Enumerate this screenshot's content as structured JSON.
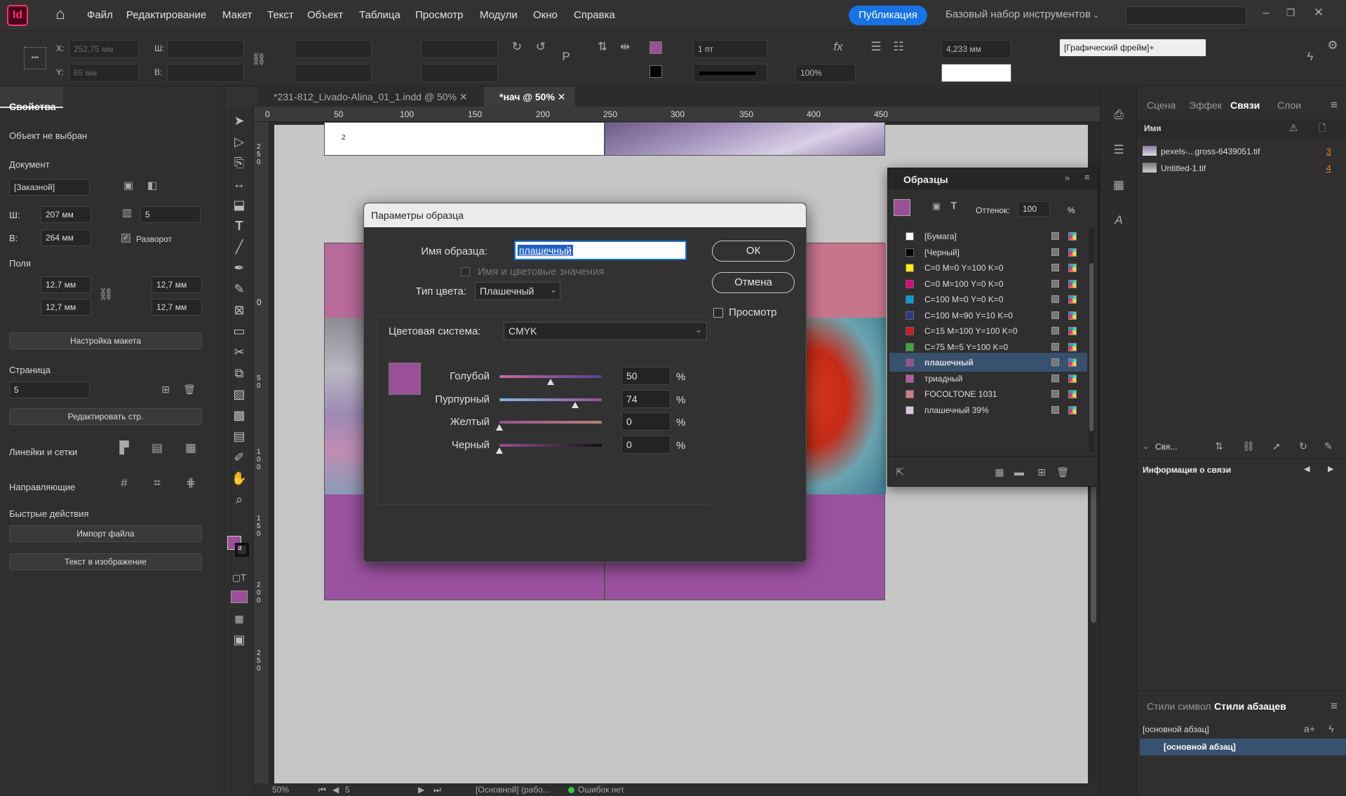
{
  "menubar": {
    "app_logo": "Id",
    "items": [
      "Файл",
      "Редактирование",
      "Макет",
      "Текст",
      "Объект",
      "Таблица",
      "Просмотр",
      "Модули",
      "Окно",
      "Справка"
    ],
    "publish_label": "Публикация",
    "workspace_label": "Базовый набор инструментов"
  },
  "controlbar": {
    "x_label": "X:",
    "x_value": "252,75 мм",
    "y_label": "Y:",
    "y_value": "65 мм",
    "w_label": "Ш:",
    "h_label": "В:",
    "stroke_weight": "1 пт",
    "opacity": "100%",
    "gap_value": "4,233 мм",
    "frame_style": "[Графический фрейм]+"
  },
  "tabs": [
    {
      "label": "*231-812_Livado-Alina_01_1.indd @ 50%"
    },
    {
      "label": "*нач @ 50%"
    }
  ],
  "properties": {
    "title": "Свойства",
    "no_selection": "Объект не выбран",
    "document_label": "Документ",
    "preset": "[Заказной]",
    "width_label": "Ш:",
    "width": "207 мм",
    "height_label": "В:",
    "height": "264 мм",
    "pages": "5",
    "spread_label": "Разворот",
    "margins_label": "Поля",
    "margin_top": "12,7 мм",
    "margin_bottom": "12,7 мм",
    "margin_left": "12,7 мм",
    "margin_right": "12,7 мм",
    "layout_button": "Настройка макета",
    "page_label": "Страница",
    "page_value": "5",
    "edit_page_button": "Редактировать стр.",
    "rulers_label": "Линейки и сетки",
    "guides_label": "Направляющие",
    "quick_actions_label": "Быстрые действия",
    "import_button": "Импорт файла",
    "text_image_button": "Текст в изображение"
  },
  "ruler": {
    "h_ticks": [
      "0",
      "50",
      "100",
      "150",
      "200",
      "250",
      "300",
      "350",
      "400",
      "450"
    ],
    "v_ticks": [
      "250",
      "0",
      "50",
      "100",
      "150",
      "200",
      "250"
    ]
  },
  "page_number_text": "2",
  "dialog": {
    "title": "Параметры образца",
    "name_label": "Имя образца:",
    "name_value": "плашечный",
    "name_with_values_label": "Имя и цветовые значения",
    "color_type_label": "Тип цвета:",
    "color_type_value": "Плашечный",
    "color_mode_label": "Цветовая система:",
    "color_mode_value": "CMYK",
    "ok_label": "ОК",
    "cancel_label": "Отмена",
    "preview_label": "Просмотр",
    "swatch_color": "#9b4f96",
    "channels": [
      {
        "label": "Голубой",
        "value": "50",
        "pct": "%"
      },
      {
        "label": "Пурпурный",
        "value": "74",
        "pct": "%"
      },
      {
        "label": "Желтый",
        "value": "0",
        "pct": "%"
      },
      {
        "label": "Черный",
        "value": "0",
        "pct": "%"
      }
    ],
    "levels": [
      0.5,
      0.74,
      0,
      0
    ]
  },
  "swatches": {
    "title": "Образцы",
    "tint_label": "Оттенок:",
    "tint_value": "100",
    "tint_pct": "%",
    "items": [
      {
        "name": "[Бумага]",
        "color": "#ffffff"
      },
      {
        "name": "[Черный]",
        "color": "#000000"
      },
      {
        "name": "C=0 M=0 Y=100 K=0",
        "color": "#ffee00"
      },
      {
        "name": "C=0 M=100 Y=0 K=0",
        "color": "#e6007e"
      },
      {
        "name": "C=100 M=0 Y=0 K=0",
        "color": "#009ee0"
      },
      {
        "name": "C=100 M=90 Y=10 K=0",
        "color": "#2b3990"
      },
      {
        "name": "C=15 M=100 Y=100 K=0",
        "color": "#d7191f"
      },
      {
        "name": "C=75 M=5 Y=100 K=0",
        "color": "#3aaa35"
      },
      {
        "name": "плашечный",
        "color": "#9b4f96"
      },
      {
        "name": "триадный",
        "color": "#b35d9f"
      },
      {
        "name": "FOCOLTONE 1031",
        "color": "#cf7b8b"
      },
      {
        "name": "плашечный 39%",
        "color": "#dcc4e0"
      }
    ]
  },
  "links_panel": {
    "tabs": [
      "Сцена",
      "Эффек",
      "Связи",
      "Слои"
    ],
    "name_header": "Имя",
    "items": [
      {
        "name": "pexels-...gross-6439051.tif",
        "page": "3"
      },
      {
        "name": "Untitled-1.tif",
        "page": "4"
      }
    ],
    "links_short": "Свя...",
    "link_info": "Информация о связи"
  },
  "styles_panel": {
    "tabs": [
      "Стили символ",
      "Стили абзацев"
    ],
    "current": "[основной абзац]",
    "item": "[основной абзац]"
  },
  "statusbar": {
    "zoom": "50%",
    "page": "5",
    "master": "[Основной] (рабо...",
    "errors": "Ошибок нет"
  },
  "colors": {
    "accent": "#1473e6",
    "page_purple": "#9a52a0",
    "page_pink": "#c8758c"
  }
}
